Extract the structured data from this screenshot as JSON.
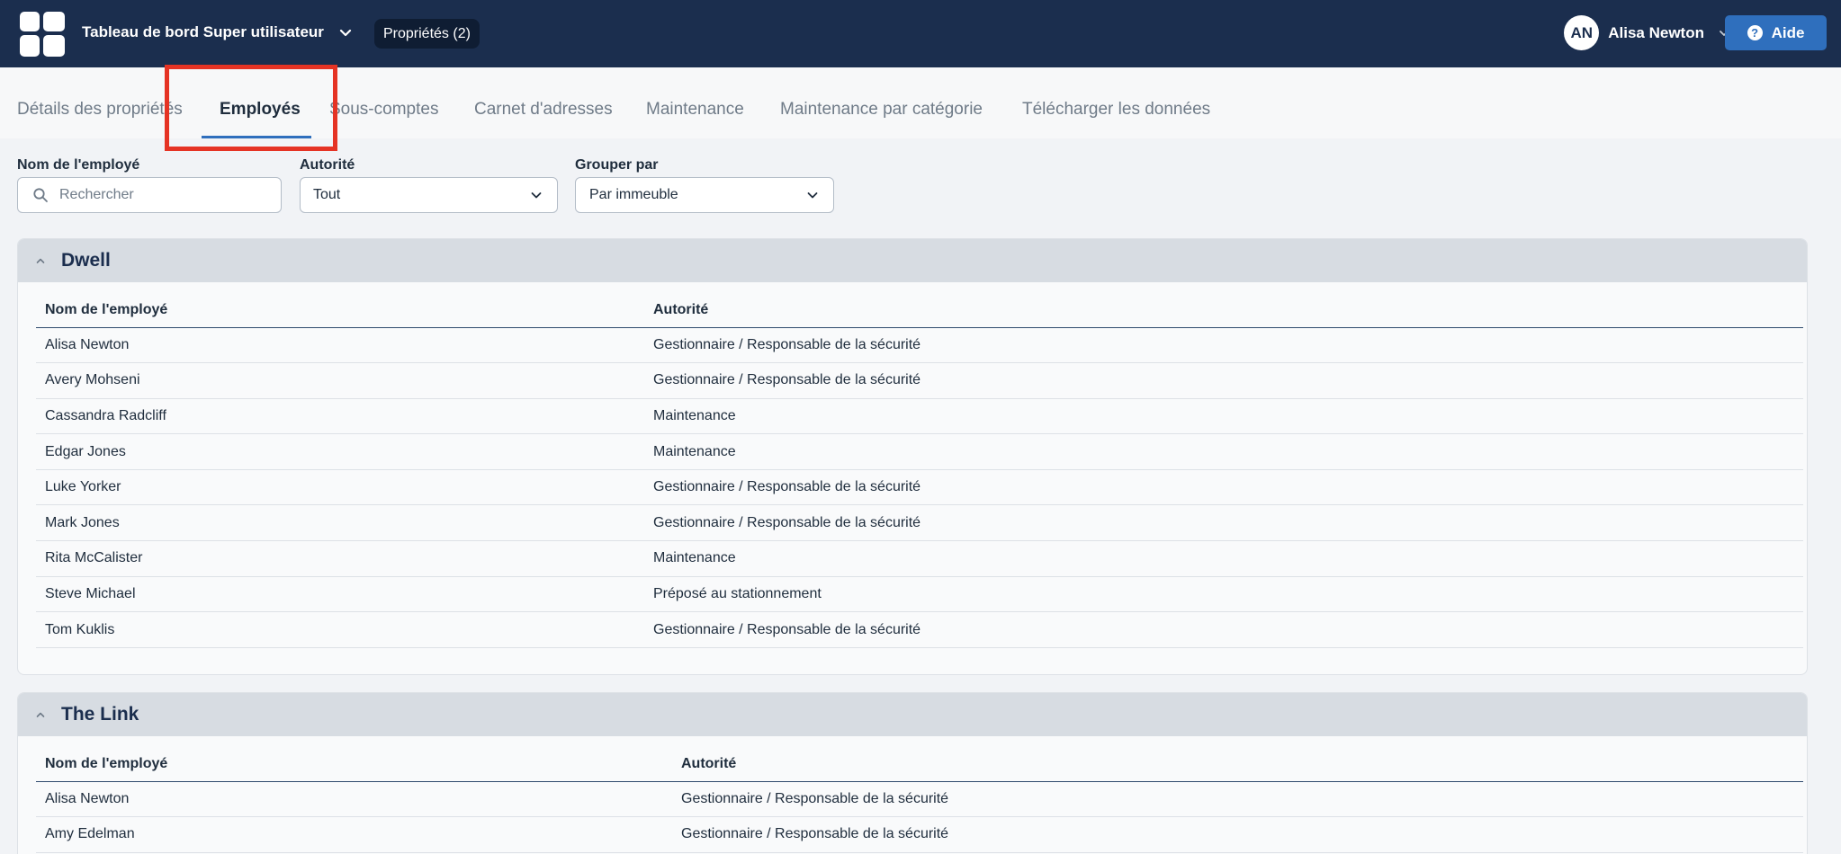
{
  "header": {
    "app_title": "Tableau de bord Super utilisateur",
    "properties_pill": "Propriétés (2)",
    "user_initials": "AN",
    "user_name": "Alisa Newton",
    "help_label": "Aide",
    "help_icon": "?"
  },
  "tabs": [
    {
      "label": "Détails des propriétés"
    },
    {
      "label": "Employés"
    },
    {
      "label": "Sous-comptes"
    },
    {
      "label": "Carnet d'adresses"
    },
    {
      "label": "Maintenance"
    },
    {
      "label": "Maintenance par catégorie"
    },
    {
      "label": "Télécharger les données"
    }
  ],
  "filters": {
    "employee_label": "Nom de l'employé",
    "search_placeholder": "Rechercher",
    "authority_label": "Autorité",
    "authority_value": "Tout",
    "group_label": "Grouper par",
    "group_value": "Par immeuble"
  },
  "groups": [
    {
      "name": "Dwell",
      "col_name": "Nom de l'employé",
      "col_authority": "Autorité",
      "rows": [
        {
          "name": "Alisa Newton",
          "authority": "Gestionnaire / Responsable de la sécurité"
        },
        {
          "name": "Avery Mohseni",
          "authority": "Gestionnaire / Responsable de la sécurité"
        },
        {
          "name": "Cassandra Radcliff",
          "authority": "Maintenance"
        },
        {
          "name": "Edgar Jones",
          "authority": "Maintenance"
        },
        {
          "name": "Luke Yorker",
          "authority": "Gestionnaire / Responsable de la sécurité"
        },
        {
          "name": "Mark Jones",
          "authority": "Gestionnaire / Responsable de la sécurité"
        },
        {
          "name": "Rita McCalister",
          "authority": "Maintenance"
        },
        {
          "name": "Steve Michael",
          "authority": "Préposé au stationnement"
        },
        {
          "name": "Tom Kuklis",
          "authority": "Gestionnaire / Responsable de la sécurité"
        }
      ]
    },
    {
      "name": "The Link",
      "col_name": "Nom de l'employé",
      "col_authority": "Autorité",
      "rows": [
        {
          "name": "Alisa Newton",
          "authority": "Gestionnaire / Responsable de la sécurité"
        },
        {
          "name": "Amy Edelman",
          "authority": "Gestionnaire / Responsable de la sécurité"
        }
      ]
    }
  ],
  "colors": {
    "header_bg": "#1b2e4e",
    "accent": "#2f6fbd",
    "highlight": "#e53324"
  },
  "icons": [
    "app-grid-icon",
    "chevron-down-icon",
    "help-icon",
    "search-icon",
    "chevron-up-icon"
  ]
}
